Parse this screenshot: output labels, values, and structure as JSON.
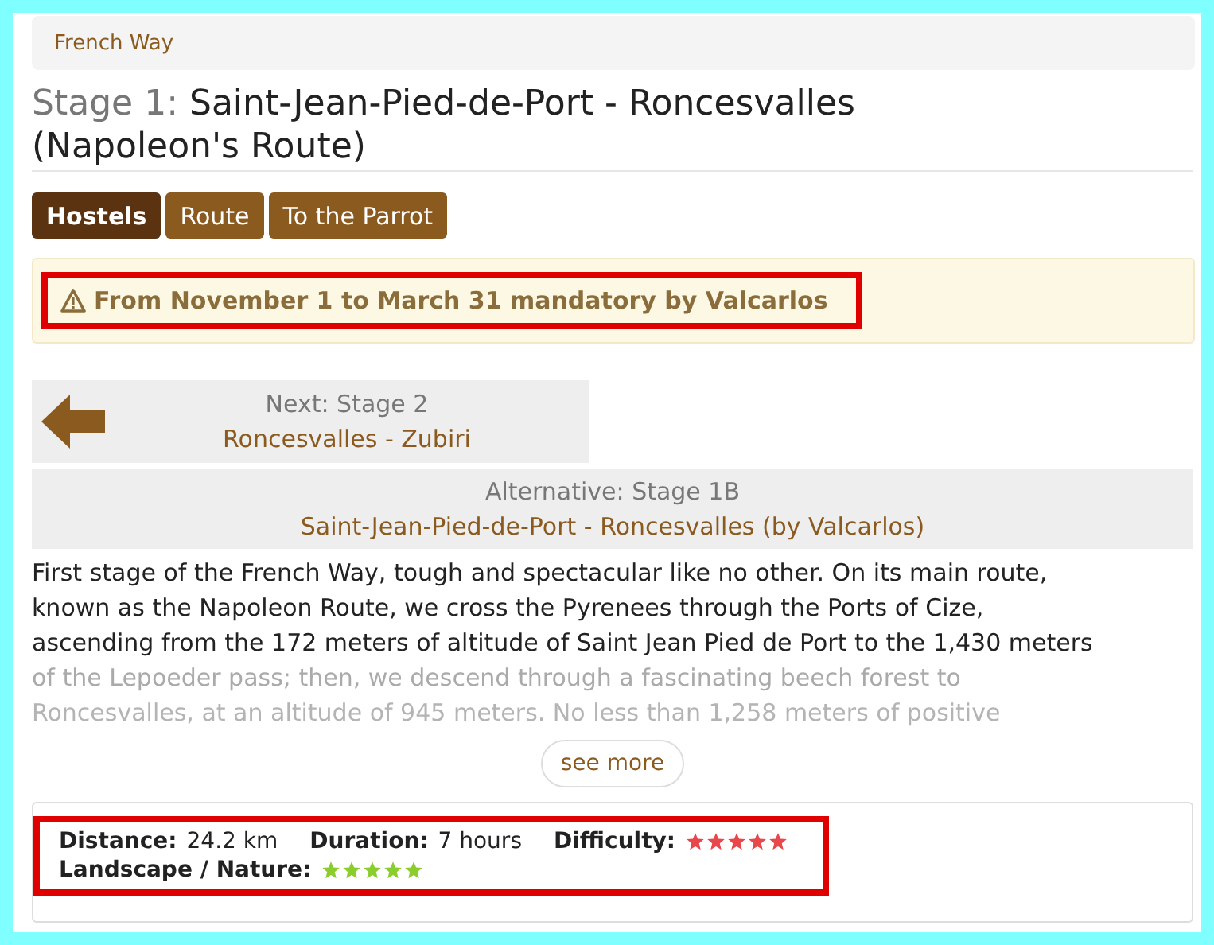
{
  "breadcrumb": "French Way",
  "title": {
    "prefix": "Stage 1:",
    "text": "Saint-Jean-Pied-de-Port - Roncesvalles (Napoleon's Route)"
  },
  "tabs": [
    {
      "label": "Hostels",
      "selected": true
    },
    {
      "label": "Route",
      "selected": false
    },
    {
      "label": "To the Parrot",
      "selected": false
    }
  ],
  "notice": {
    "text": "From November 1 to March 31 mandatory by Valcarlos",
    "highlighted": true
  },
  "next": {
    "label": "Next: Stage 2",
    "route": "Roncesvalles - Zubiri"
  },
  "alternative": {
    "label": "Alternative: Stage 1B",
    "route": "Saint-Jean-Pied-de-Port - Roncesvalles (by Valcarlos)"
  },
  "description": [
    {
      "text": "First stage of the French Way, tough and spectacular like no other. On its main route,",
      "faded": false
    },
    {
      "text": "known as the Napoleon Route, we cross the Pyrenees through the Ports of Cize,",
      "faded": false
    },
    {
      "text": "ascending from the 172 meters of altitude of Saint Jean Pied de Port to the 1,430 meters",
      "faded": false
    },
    {
      "text": "of the Lepoeder pass; then, we descend through a fascinating beech forest to",
      "faded": true
    },
    {
      "text": "Roncesvalles, at an altitude of 945 meters. No less than 1,258 meters of positive",
      "faded": true
    }
  ],
  "see_more": "see more",
  "stats": {
    "highlighted": true,
    "items": [
      {
        "kind": "text",
        "label": "Distance:",
        "value": "24.2 km"
      },
      {
        "kind": "text",
        "label": "Duration:",
        "value": "7 hours"
      },
      {
        "kind": "stars",
        "label": "Difficulty:",
        "stars": 5,
        "color": "#e8474c"
      },
      {
        "kind": "stars",
        "label": "Landscape / Nature:",
        "stars": 5,
        "color": "#8acd2c"
      }
    ]
  }
}
